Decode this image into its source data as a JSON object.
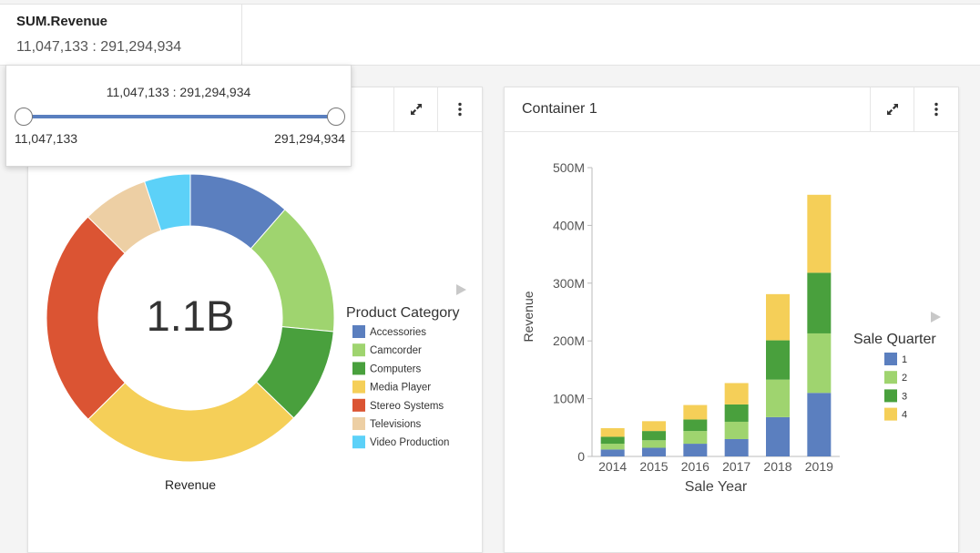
{
  "filter": {
    "title": "SUM.Revenue",
    "value": "11,047,133 : 291,294,934"
  },
  "range_popup": {
    "label": "11,047,133 : 291,294,934",
    "min_label": "11,047,133",
    "max_label": "291,294,934",
    "low_fraction": 0,
    "high_fraction": 1
  },
  "left_panel": {
    "center_value": "1.1B",
    "caption": "Revenue"
  },
  "right_panel": {
    "title": "Container 1"
  },
  "colors": {
    "accent": "#5a7fbf"
  },
  "icons": [
    "expand-icon",
    "more-vertical-icon",
    "legend-arrow-icon"
  ],
  "chart_data": [
    {
      "type": "pie",
      "variant": "donut",
      "legend_title": "Product Category",
      "categories": [
        "Accessories",
        "Camcorder",
        "Computers",
        "Media Player",
        "Stereo Systems",
        "Televisions",
        "Video Production"
      ],
      "values": [
        0.115,
        0.152,
        0.108,
        0.255,
        0.25,
        0.075,
        0.052
      ],
      "colors": [
        "#5b7fbf",
        "#9fd46f",
        "#49a03d",
        "#f5cf58",
        "#db5433",
        "#edcfa4",
        "#5cd1f8"
      ],
      "center_label": "1.1B",
      "caption": "Revenue",
      "legend_position": "right"
    },
    {
      "type": "bar",
      "stacked": true,
      "categories": [
        "2014",
        "2015",
        "2016",
        "2017",
        "2018",
        "2019"
      ],
      "series": [
        {
          "name": "1",
          "values": [
            12,
            15,
            22,
            30,
            68,
            110
          ],
          "color": "#5b7fbf"
        },
        {
          "name": "2",
          "values": [
            10,
            13,
            22,
            30,
            65,
            103
          ],
          "color": "#9fd46f"
        },
        {
          "name": "3",
          "values": [
            12,
            16,
            20,
            30,
            68,
            105
          ],
          "color": "#49a03d"
        },
        {
          "name": "4",
          "values": [
            15,
            17,
            25,
            37,
            80,
            135
          ],
          "color": "#f5cf58"
        }
      ],
      "xlabel": "Sale Year",
      "ylabel": "Revenue",
      "legend_title": "Sale Quarter",
      "ylim": [
        0,
        500
      ],
      "yticks": [
        0,
        100,
        200,
        300,
        400,
        500
      ],
      "ytick_labels": [
        "0",
        "100M",
        "200M",
        "300M",
        "400M",
        "500M"
      ],
      "legend_position": "right"
    }
  ]
}
